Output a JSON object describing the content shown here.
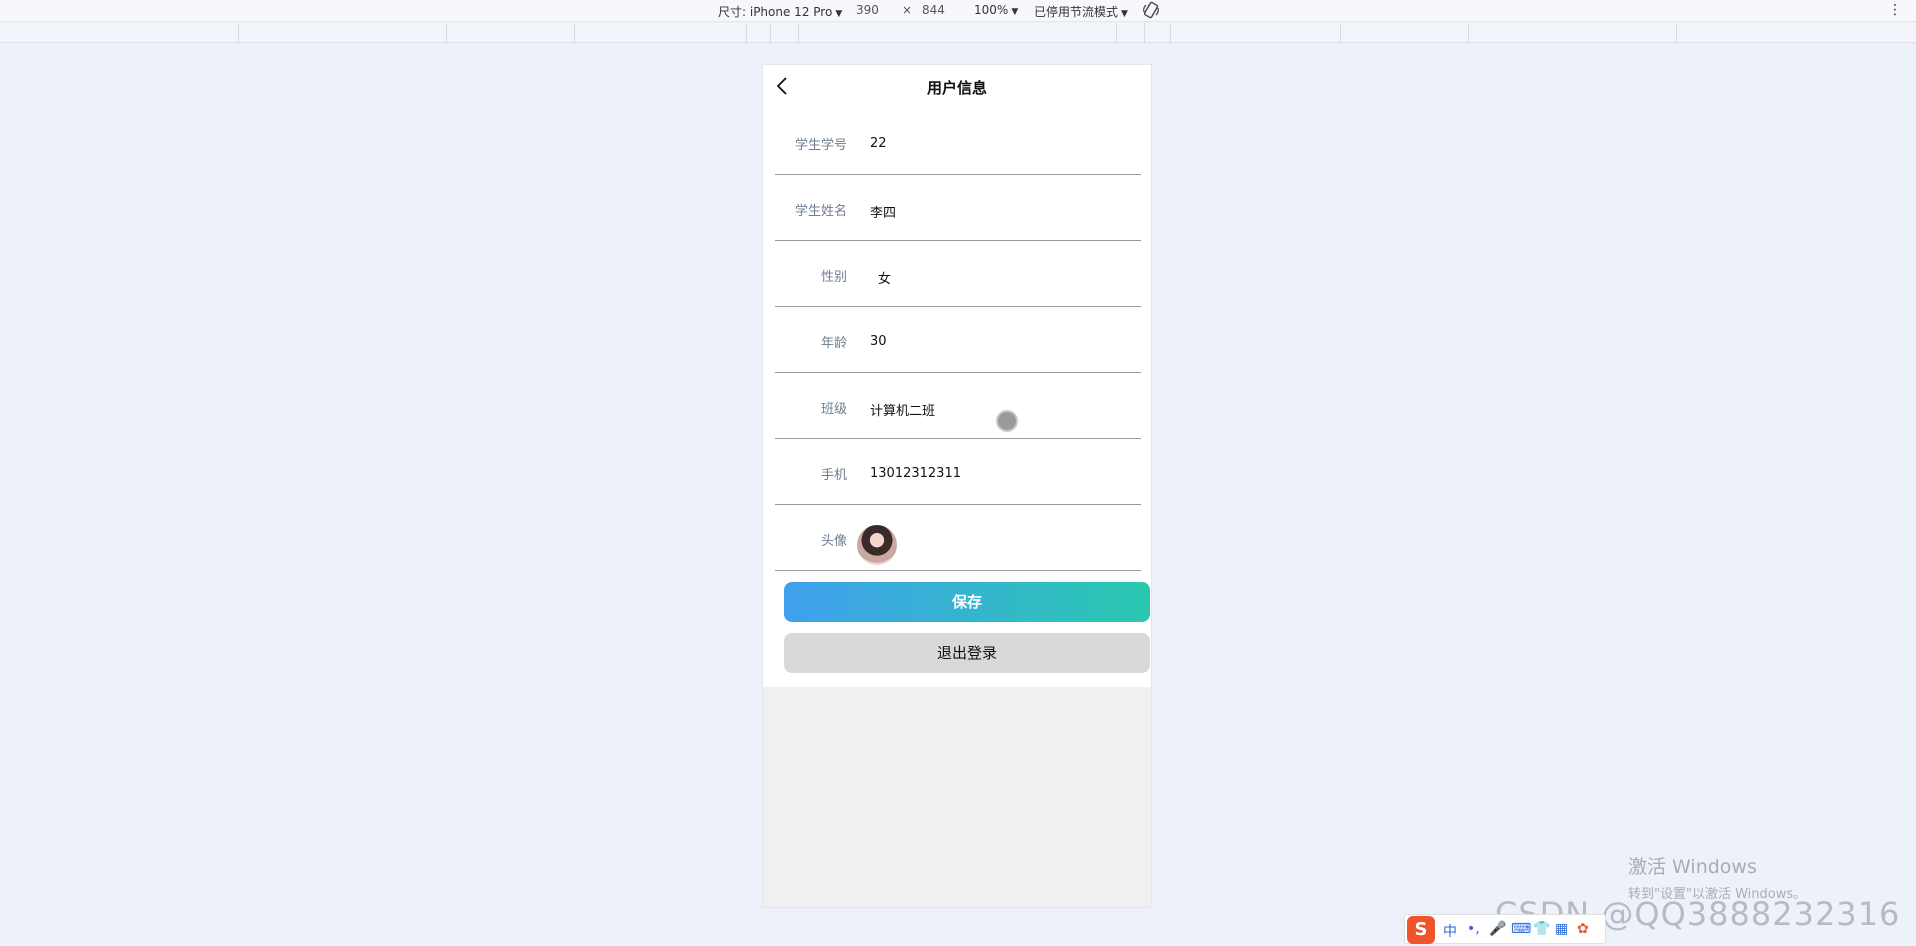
{
  "devtools": {
    "device_label": "尺寸: iPhone 12 Pro",
    "width": "390",
    "times": "×",
    "height": "844",
    "zoom": "100%",
    "throttle": "已停用节流模式"
  },
  "header": {
    "title": "用户信息"
  },
  "form": {
    "rows": [
      {
        "label": "学生学号",
        "value": "22"
      },
      {
        "label": "学生姓名",
        "value": "李四"
      },
      {
        "label": "性别",
        "value": "女"
      },
      {
        "label": "年龄",
        "value": "30"
      },
      {
        "label": "班级",
        "value": "计算机二班"
      },
      {
        "label": "手机",
        "value": "13012312311"
      },
      {
        "label": "头像"
      }
    ]
  },
  "buttons": {
    "save": "保存",
    "logout": "退出登录"
  },
  "watermark": {
    "line1": "激活 Windows",
    "line2": "转到\"设置\"以激活 Windows。",
    "csdn": "CSDN @QQ3888232316"
  },
  "ime": {
    "mode": "中",
    "s_logo": "S"
  },
  "colors": {
    "save_start": "#40a0ee",
    "save_end": "#2ac8b0",
    "label": "#6f7d92"
  }
}
